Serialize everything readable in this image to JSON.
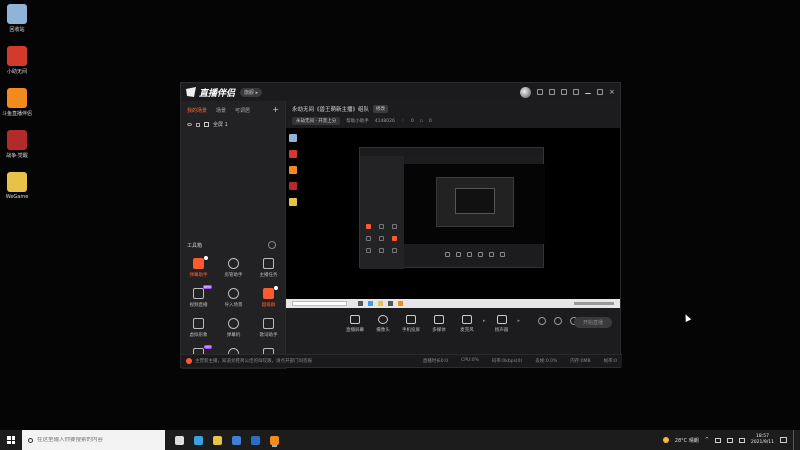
{
  "desktop": {
    "icons": [
      {
        "label": "回收站",
        "icon": "recycle-bin-icon",
        "color": "#8fb4d8"
      },
      {
        "label": "小助无间",
        "icon": "app-icon",
        "color": "#d23b2b"
      },
      {
        "label": "斗鱼直播伴侣",
        "icon": "douyu-icon",
        "color": "#f28b1c"
      },
      {
        "label": "战争·觉醒",
        "icon": "game-icon",
        "color": "#b22a2a"
      },
      {
        "label": "WeGame",
        "icon": "wegame-icon",
        "color": "#e7c24a"
      }
    ]
  },
  "window": {
    "app_name": "直播伴侣",
    "version_badge": "旗舰 ▸",
    "left_tabs": [
      "我的场景",
      "场景",
      "可调居"
    ],
    "active_tab": 0,
    "scene_label": "全屏 1",
    "toolbox_title": "工具箱",
    "tools": [
      {
        "label": "弹幕助手",
        "accent": true,
        "dot": true
      },
      {
        "label": "房管助手",
        "accent": false
      },
      {
        "label": "主播任务",
        "accent": false
      },
      {
        "label": "视频直播",
        "accent": false,
        "new": "NEW"
      },
      {
        "label": "导入场景",
        "accent": false
      },
      {
        "label": "超级群",
        "accent": true,
        "dot": true
      },
      {
        "label": "虚拟形象",
        "accent": false
      },
      {
        "label": "弹幕机",
        "accent": false
      },
      {
        "label": "歌词助手",
        "accent": false
      },
      {
        "label": "",
        "accent": false,
        "new": "HOT"
      },
      {
        "label": "",
        "accent": false
      },
      {
        "label": "",
        "accent": false
      }
    ],
    "stream": {
      "title": "永劫无间《兽王萌新主播》组队",
      "edit_label": "修改",
      "category": "永劫无间 · 开黑上分",
      "room_label": "帮助小助手",
      "room_id": "4148026",
      "likes": "0",
      "views": "0"
    },
    "controls": [
      {
        "label": "直播屏幕",
        "icon": "screen-icon"
      },
      {
        "label": "摄像头",
        "icon": "camera-icon"
      },
      {
        "label": "手机投屏",
        "icon": "phone-icon"
      },
      {
        "label": "多媒体",
        "icon": "media-icon"
      },
      {
        "label": "麦克风",
        "icon": "mic-icon"
      },
      {
        "label": "扬声器",
        "icon": "speaker-icon"
      }
    ],
    "start_live": "开始直播",
    "status": {
      "notice": "主营新主播，知道兑鞋简公佳的叫咬跟，请点开部门叫签报",
      "stats": [
        "直播时长0:0",
        "CPU:0%",
        "码率:0kbps(0)",
        "丢帧:0.0%",
        "内存:0MB",
        "帧率:0"
      ]
    }
  },
  "taskbar": {
    "search_placeholder": "在这里输入你要搜索的内容",
    "apps": [
      {
        "icon": "task-view-icon",
        "color": "#dddddd"
      },
      {
        "icon": "edge-icon",
        "color": "#3aa0e0"
      },
      {
        "icon": "explorer-icon",
        "color": "#e8c24a"
      },
      {
        "icon": "store-icon",
        "color": "#3d7fd6"
      },
      {
        "icon": "mail-icon",
        "color": "#2b6fc4"
      },
      {
        "icon": "douyu-icon",
        "color": "#f28b1c"
      }
    ],
    "weather": "28°C 晴朗",
    "time": "18:57",
    "date": "2021/9/11"
  }
}
